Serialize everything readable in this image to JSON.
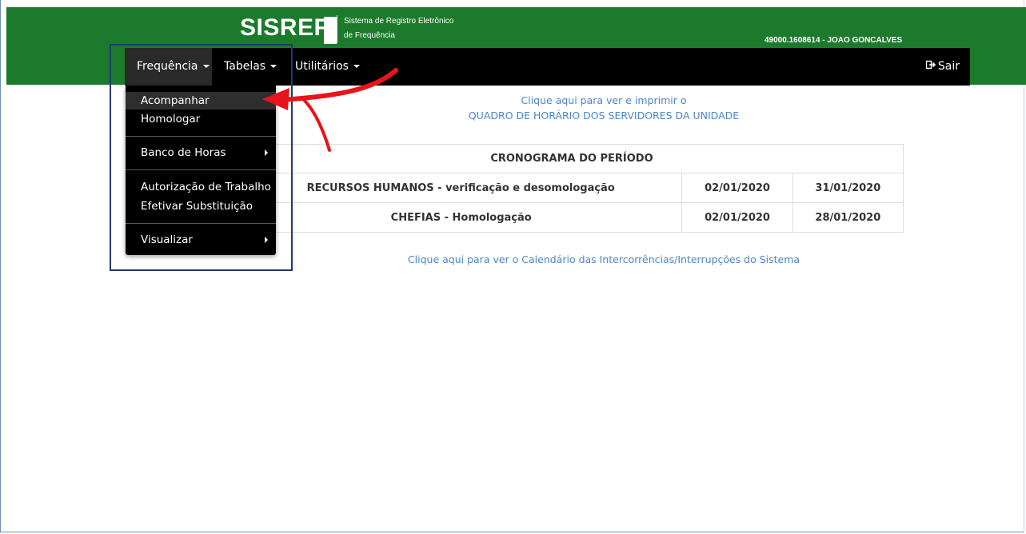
{
  "header": {
    "logo": "SISREF",
    "subtitle_line1": "Sistema de Registro Eletrônico",
    "subtitle_line2": "de Frequência",
    "user": "49000.1608614 - JOAO GONCALVES"
  },
  "nav": {
    "items": [
      {
        "label": "Frequência"
      },
      {
        "label": "Tabelas"
      },
      {
        "label": "Utilitários"
      }
    ],
    "logout": "Sair"
  },
  "dropdown": {
    "items": [
      {
        "label": "Acompanhar"
      },
      {
        "label": "Homologar"
      },
      {
        "label": "Banco de Horas"
      },
      {
        "label": "Autorização de Trabalho"
      },
      {
        "label": "Efetivar Substituição"
      },
      {
        "label": "Visualizar"
      }
    ]
  },
  "main": {
    "print_link_line1": "Clique aqui para ver e imprimir o",
    "print_link_line2": "QUADRO DE HORÁRIO DOS SERVIDORES DA UNIDADE",
    "calendar_link": "Clique aqui para ver o Calendário das Intercorrências/Interrupções do Sistema",
    "schedule": {
      "title": "CRONOGRAMA DO PERÍODO",
      "rows": [
        {
          "label": "RECURSOS HUMANOS - verificação e desomologação",
          "start": "02/01/2020",
          "end": "31/01/2020"
        },
        {
          "label": "CHEFIAS - Homologação",
          "start": "02/01/2020",
          "end": "28/01/2020"
        }
      ]
    }
  },
  "colors": {
    "header_green": "#1c7a2c",
    "navbar": "#000000",
    "link_blue": "#4d86c4",
    "annotation_red": "#e8141b",
    "annotation_box": "#1f3a6e"
  }
}
